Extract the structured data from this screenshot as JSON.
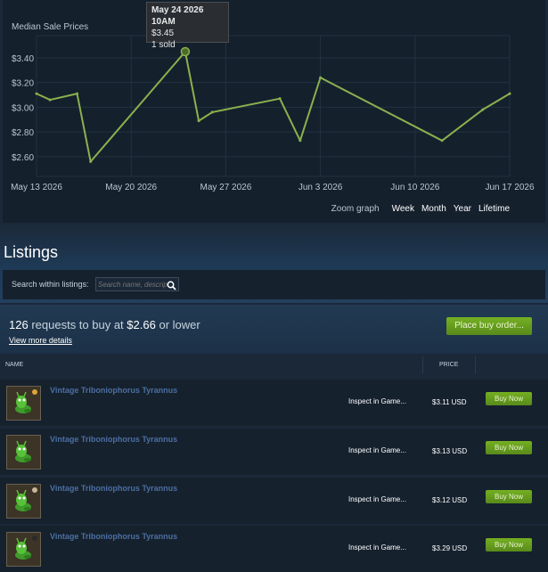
{
  "chart": {
    "title": "Median Sale Prices",
    "zoom_label": "Zoom graph",
    "zoom_options": [
      "Week",
      "Month",
      "Year",
      "Lifetime"
    ],
    "tooltip": {
      "date": "May 24 2026 10AM",
      "price": "$3.45",
      "sold": "1 sold"
    }
  },
  "chart_data": {
    "type": "line",
    "ylim": [
      2.44,
      3.58
    ],
    "yticks": [
      "$3.40",
      "$3.20",
      "$3.00",
      "$2.80",
      "$2.60"
    ],
    "ytick_values": [
      3.4,
      3.2,
      3.0,
      2.8,
      2.6
    ],
    "xlim": [
      "2026-05-13",
      "2026-06-17"
    ],
    "xticks": [
      "May 13 2026",
      "May 20 2026",
      "May 27 2026",
      "Jun 3 2026",
      "Jun 10 2026",
      "Jun 17 2026"
    ],
    "xtick_days": [
      0,
      7,
      14,
      21,
      28,
      35
    ],
    "line_color": "#8bb14d",
    "series": [
      {
        "x": [
          0,
          1,
          3,
          4,
          11,
          12,
          13,
          18,
          19.5,
          21,
          30,
          33,
          35
        ],
        "y": [
          3.11,
          3.06,
          3.11,
          2.56,
          3.45,
          2.89,
          2.96,
          3.07,
          2.73,
          3.24,
          2.73,
          2.98,
          3.11
        ]
      }
    ],
    "highlight_index": 4
  },
  "listings": {
    "title": "Listings",
    "search_label": "Search within listings:",
    "search_placeholder": "Search name, description",
    "buy_count": "126",
    "buy_text_mid": "requests to buy at",
    "buy_price": "$2.66",
    "buy_text_end": "or lower",
    "view_more": "View more details",
    "place_order": "Place buy order...",
    "col_name": "NAME",
    "col_price": "PRICE",
    "rows": [
      {
        "name": "Vintage Triboniophorus Tyrannus",
        "inspect": "Inspect in Game...",
        "price": "$3.11 USD",
        "buy": "Buy Now",
        "dot": "#e0a43a"
      },
      {
        "name": "Vintage Triboniophorus Tyrannus",
        "inspect": "Inspect in Game...",
        "price": "$3.13 USD",
        "buy": "Buy Now",
        "dot": ""
      },
      {
        "name": "Vintage Triboniophorus Tyrannus",
        "inspect": "Inspect in Game...",
        "price": "$3.12 USD",
        "buy": "Buy Now",
        "dot": "#c8b89a"
      },
      {
        "name": "Vintage Triboniophorus Tyrannus",
        "inspect": "Inspect in Game...",
        "price": "$3.29 USD",
        "buy": "Buy Now",
        "dot": "#2a2a2a"
      }
    ]
  }
}
